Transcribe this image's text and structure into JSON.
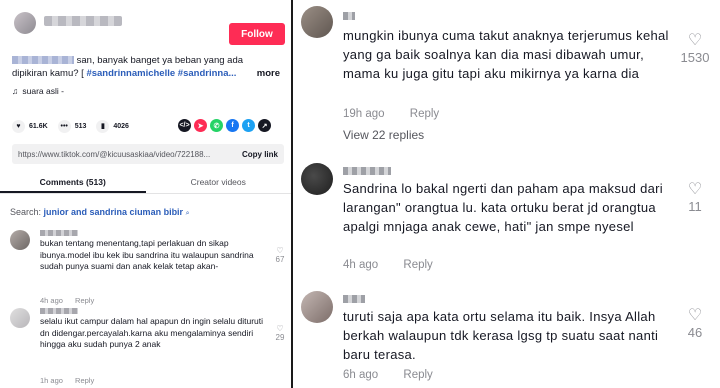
{
  "left": {
    "follow_label": "Follow",
    "caption_text": "san, banyak banget ya beban yang ada dipikiran kamu? [",
    "caption_tags": "#sandrinnamichelle #sandrinna...",
    "more_label": "more",
    "sound_label": "suara asli -",
    "stats": {
      "likes": "61.6K",
      "comments": "513",
      "saves": "4026"
    },
    "url": "https://www.tiktok.com/@kicuusaskiaa/video/722188...",
    "copy_link_label": "Copy link",
    "tabs": [
      "Comments (513)",
      "Creator videos"
    ],
    "search_prefix": "Search:",
    "search_term": "junior and sandrina ciuman bibir",
    "comments": [
      {
        "text": "bukan tentang menentang,tapi perlakuan dn sikap ibunya.model ibu kek ibu sandrina itu walaupun sandrina sudah punya suami dan anak kelak tetap akan-",
        "time": "4h ago",
        "reply": "Reply",
        "likes": "67"
      },
      {
        "text": "selalu ikut campur dalam hal apapun dn ingin selalu dituruti dn didengar.percayalah.karna aku mengalaminya sendiri hingga aku sudah punya 2 anak",
        "time": "1h ago",
        "reply": "Reply",
        "likes": "29"
      }
    ]
  },
  "right": {
    "comments": [
      {
        "text": "mungkin ibunya cuma takut anaknya terjerumus kehal yang ga baik soalnya kan dia masi dibawah umur, mama ku juga gitu tapi aku mikirnya ya karna dia",
        "time": "19h ago",
        "reply": "Reply",
        "likes": "1530",
        "view_replies": "View 22 replies"
      },
      {
        "text": "Sandrina lo bakal ngerti dan paham apa maksud dari larangan\" orangtua lu. kata ortuku berat jd orangtua apalgi mnjaga anak cewe, hati\" jan smpe nyesel",
        "time": "4h ago",
        "reply": "Reply",
        "likes": "11"
      },
      {
        "text": "turuti saja apa kata ortu selama itu baik. Insya Allah berkah walaupun tdk kerasa lgsg tp suatu saat nanti baru terasa.",
        "time": "6h ago",
        "reply": "Reply",
        "likes": "46"
      }
    ]
  }
}
